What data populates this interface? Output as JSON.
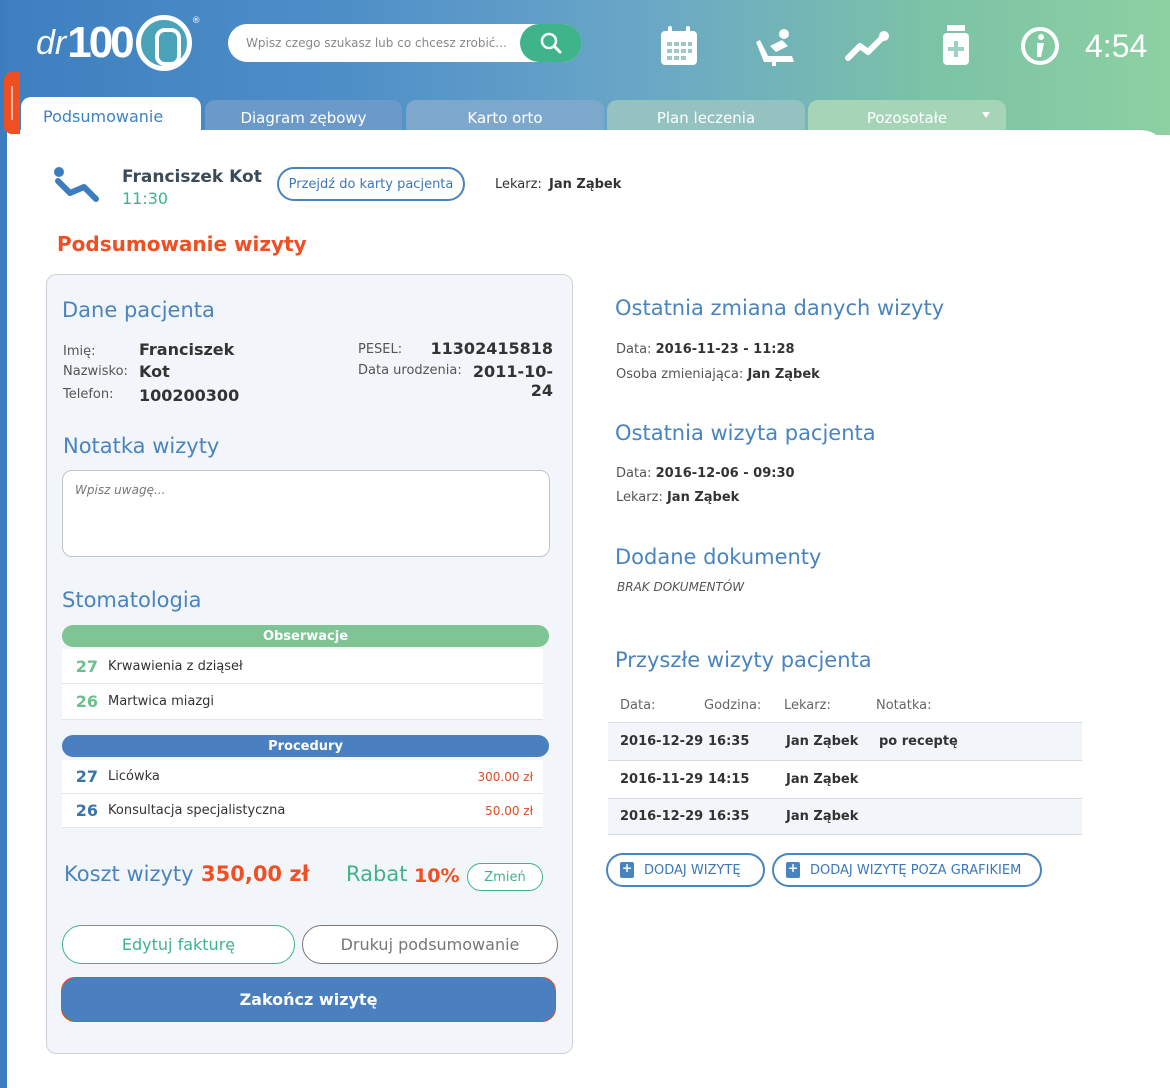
{
  "header": {
    "logo_dr": "dr",
    "logo_100": "100",
    "logo_reg": "®",
    "search_placeholder": "Wpisz czego szukasz lub co chcesz zrobić...",
    "clock": "4:54",
    "icons": [
      "calendar-icon",
      "dentist-chair-icon",
      "chart-trend-icon",
      "medicine-icon",
      "info-icon"
    ]
  },
  "tabs": [
    {
      "label": "Podsumowanie",
      "active": true
    },
    {
      "label": "Diagram zębowy"
    },
    {
      "label": "Karto orto"
    },
    {
      "label": "Plan leczenia"
    },
    {
      "label": "Pozosotałe"
    }
  ],
  "patient": {
    "name": "Franciszek Kot",
    "time": "11:30",
    "go_to_card": "Przejdź do karty pacjenta",
    "doctor_label": "Lekarz:",
    "doctor": "Jan Ząbek"
  },
  "page_title": "Podsumowanie wizyty",
  "patient_data": {
    "title": "Dane pacjenta",
    "first_name_label": "Imię:",
    "first_name": "Franciszek",
    "last_name_label": "Nazwisko:",
    "last_name": "Kot",
    "phone_label": "Telefon:",
    "phone": "100200300",
    "pesel_label": "PESEL:",
    "pesel": "11302415818",
    "birth_label": "Data urodzenia:",
    "birth": "2011-10-24"
  },
  "visit_note": {
    "title": "Notatka wizyty",
    "placeholder": "Wpisz uwagę..."
  },
  "dentistry": {
    "title": "Stomatologia",
    "observations_title": "Obserwacje",
    "observations": [
      {
        "tooth": "27",
        "desc": "Krwawienia z dziąseł"
      },
      {
        "tooth": "26",
        "desc": "Martwica miazgi"
      }
    ],
    "procedures_title": "Procedury",
    "procedures": [
      {
        "tooth": "27",
        "desc": "Licówka",
        "price": "300.00 zł"
      },
      {
        "tooth": "26",
        "desc": "Konsultacja specjalistyczna",
        "price": "50.00 zł"
      }
    ]
  },
  "cost": {
    "label": "Koszt wizyty",
    "value": "350,00 zł",
    "discount_label": "Rabat",
    "discount_value": "10%",
    "change_label": "Zmień"
  },
  "actions": {
    "edit_invoice": "Edytuj fakturę",
    "print_summary": "Drukuj podsumowanie",
    "finish_visit": "Zakończ wizytę"
  },
  "last_change": {
    "title": "Ostatnia zmiana danych wizyty",
    "date_label": "Data:",
    "date": "2016-11-23 - 11:28",
    "person_label": "Osoba zmieniająca:",
    "person": "Jan Ząbek"
  },
  "last_visit": {
    "title": "Ostatnia wizyta pacjenta",
    "date_label": "Data:",
    "date": "2016-12-06 - 09:30",
    "doctor_label": "Lekarz:",
    "doctor": "Jan Ząbek"
  },
  "documents": {
    "title": "Dodane dokumenty",
    "empty": "BRAK DOKUMENTÓW"
  },
  "future_visits": {
    "title": "Przyszłe wizyty pacjenta",
    "columns": [
      "Data:",
      "Godzina:",
      "Lekarz:",
      "Notatka:"
    ],
    "rows": [
      {
        "date": "2016-12-29",
        "time": "16:35",
        "doctor": "Jan Ząbek",
        "note": "po receptę"
      },
      {
        "date": "2016-11-29",
        "time": "14:15",
        "doctor": "Jan Ząbek",
        "note": ""
      },
      {
        "date": "2016-12-29",
        "time": "16:35",
        "doctor": "Jan Ząbek",
        "note": ""
      }
    ],
    "add_visit": "DODAJ WIZYTĘ",
    "add_visit_outside": "DODAJ WIZYTĘ POZA GRAFIKIEM"
  },
  "colors": {
    "accent_blue": "#4a84bf",
    "accent_green": "#3fb38a",
    "accent_orange": "#f04e23"
  }
}
